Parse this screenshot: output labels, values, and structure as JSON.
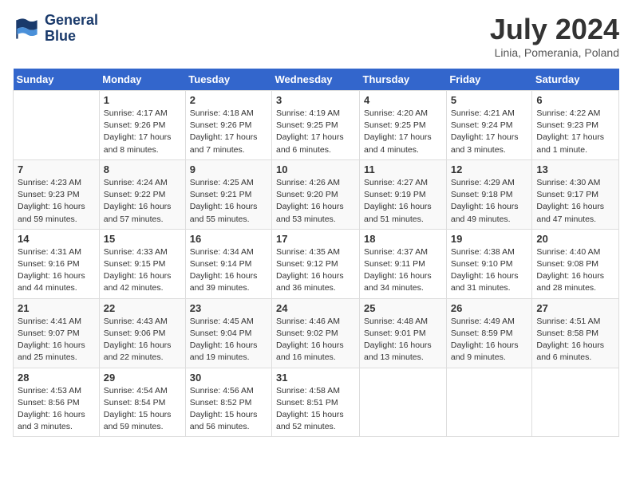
{
  "header": {
    "logo_line1": "General",
    "logo_line2": "Blue",
    "month_title": "July 2024",
    "location": "Linia, Pomerania, Poland"
  },
  "days_of_week": [
    "Sunday",
    "Monday",
    "Tuesday",
    "Wednesday",
    "Thursday",
    "Friday",
    "Saturday"
  ],
  "weeks": [
    [
      {
        "num": "",
        "info": ""
      },
      {
        "num": "1",
        "info": "Sunrise: 4:17 AM\nSunset: 9:26 PM\nDaylight: 17 hours\nand 8 minutes."
      },
      {
        "num": "2",
        "info": "Sunrise: 4:18 AM\nSunset: 9:26 PM\nDaylight: 17 hours\nand 7 minutes."
      },
      {
        "num": "3",
        "info": "Sunrise: 4:19 AM\nSunset: 9:25 PM\nDaylight: 17 hours\nand 6 minutes."
      },
      {
        "num": "4",
        "info": "Sunrise: 4:20 AM\nSunset: 9:25 PM\nDaylight: 17 hours\nand 4 minutes."
      },
      {
        "num": "5",
        "info": "Sunrise: 4:21 AM\nSunset: 9:24 PM\nDaylight: 17 hours\nand 3 minutes."
      },
      {
        "num": "6",
        "info": "Sunrise: 4:22 AM\nSunset: 9:23 PM\nDaylight: 17 hours\nand 1 minute."
      }
    ],
    [
      {
        "num": "7",
        "info": "Sunrise: 4:23 AM\nSunset: 9:23 PM\nDaylight: 16 hours\nand 59 minutes."
      },
      {
        "num": "8",
        "info": "Sunrise: 4:24 AM\nSunset: 9:22 PM\nDaylight: 16 hours\nand 57 minutes."
      },
      {
        "num": "9",
        "info": "Sunrise: 4:25 AM\nSunset: 9:21 PM\nDaylight: 16 hours\nand 55 minutes."
      },
      {
        "num": "10",
        "info": "Sunrise: 4:26 AM\nSunset: 9:20 PM\nDaylight: 16 hours\nand 53 minutes."
      },
      {
        "num": "11",
        "info": "Sunrise: 4:27 AM\nSunset: 9:19 PM\nDaylight: 16 hours\nand 51 minutes."
      },
      {
        "num": "12",
        "info": "Sunrise: 4:29 AM\nSunset: 9:18 PM\nDaylight: 16 hours\nand 49 minutes."
      },
      {
        "num": "13",
        "info": "Sunrise: 4:30 AM\nSunset: 9:17 PM\nDaylight: 16 hours\nand 47 minutes."
      }
    ],
    [
      {
        "num": "14",
        "info": "Sunrise: 4:31 AM\nSunset: 9:16 PM\nDaylight: 16 hours\nand 44 minutes."
      },
      {
        "num": "15",
        "info": "Sunrise: 4:33 AM\nSunset: 9:15 PM\nDaylight: 16 hours\nand 42 minutes."
      },
      {
        "num": "16",
        "info": "Sunrise: 4:34 AM\nSunset: 9:14 PM\nDaylight: 16 hours\nand 39 minutes."
      },
      {
        "num": "17",
        "info": "Sunrise: 4:35 AM\nSunset: 9:12 PM\nDaylight: 16 hours\nand 36 minutes."
      },
      {
        "num": "18",
        "info": "Sunrise: 4:37 AM\nSunset: 9:11 PM\nDaylight: 16 hours\nand 34 minutes."
      },
      {
        "num": "19",
        "info": "Sunrise: 4:38 AM\nSunset: 9:10 PM\nDaylight: 16 hours\nand 31 minutes."
      },
      {
        "num": "20",
        "info": "Sunrise: 4:40 AM\nSunset: 9:08 PM\nDaylight: 16 hours\nand 28 minutes."
      }
    ],
    [
      {
        "num": "21",
        "info": "Sunrise: 4:41 AM\nSunset: 9:07 PM\nDaylight: 16 hours\nand 25 minutes."
      },
      {
        "num": "22",
        "info": "Sunrise: 4:43 AM\nSunset: 9:06 PM\nDaylight: 16 hours\nand 22 minutes."
      },
      {
        "num": "23",
        "info": "Sunrise: 4:45 AM\nSunset: 9:04 PM\nDaylight: 16 hours\nand 19 minutes."
      },
      {
        "num": "24",
        "info": "Sunrise: 4:46 AM\nSunset: 9:02 PM\nDaylight: 16 hours\nand 16 minutes."
      },
      {
        "num": "25",
        "info": "Sunrise: 4:48 AM\nSunset: 9:01 PM\nDaylight: 16 hours\nand 13 minutes."
      },
      {
        "num": "26",
        "info": "Sunrise: 4:49 AM\nSunset: 8:59 PM\nDaylight: 16 hours\nand 9 minutes."
      },
      {
        "num": "27",
        "info": "Sunrise: 4:51 AM\nSunset: 8:58 PM\nDaylight: 16 hours\nand 6 minutes."
      }
    ],
    [
      {
        "num": "28",
        "info": "Sunrise: 4:53 AM\nSunset: 8:56 PM\nDaylight: 16 hours\nand 3 minutes."
      },
      {
        "num": "29",
        "info": "Sunrise: 4:54 AM\nSunset: 8:54 PM\nDaylight: 15 hours\nand 59 minutes."
      },
      {
        "num": "30",
        "info": "Sunrise: 4:56 AM\nSunset: 8:52 PM\nDaylight: 15 hours\nand 56 minutes."
      },
      {
        "num": "31",
        "info": "Sunrise: 4:58 AM\nSunset: 8:51 PM\nDaylight: 15 hours\nand 52 minutes."
      },
      {
        "num": "",
        "info": ""
      },
      {
        "num": "",
        "info": ""
      },
      {
        "num": "",
        "info": ""
      }
    ]
  ]
}
